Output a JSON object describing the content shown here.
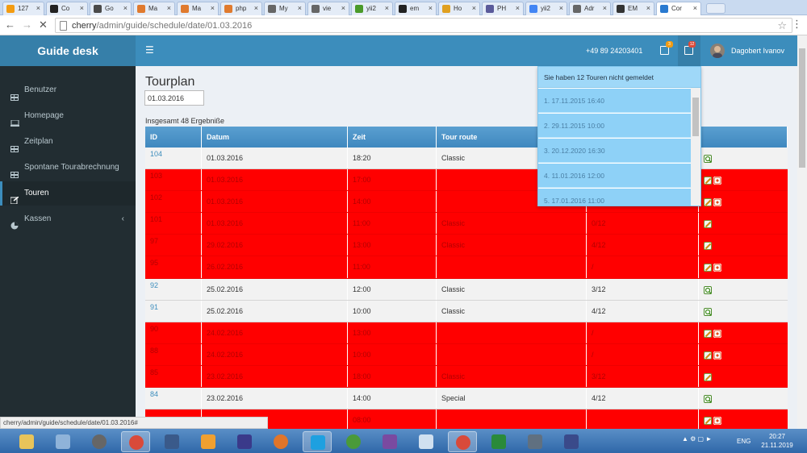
{
  "browser": {
    "tabs": [
      {
        "label": "127",
        "color": "#f39c12"
      },
      {
        "label": "Co",
        "color": "#222222"
      },
      {
        "label": "Go",
        "color": "#4a4a4a"
      },
      {
        "label": "Ma",
        "color": "#e07a2e"
      },
      {
        "label": "Ma",
        "color": "#e07a2e"
      },
      {
        "label": "php",
        "color": "#e07a2e"
      },
      {
        "label": "My",
        "color": "#666666"
      },
      {
        "label": "vie",
        "color": "#666666"
      },
      {
        "label": "yii2",
        "color": "#4a9a2a"
      },
      {
        "label": "em",
        "color": "#222222"
      },
      {
        "label": "Ho",
        "color": "#e0a020"
      },
      {
        "label": "PH",
        "color": "#5a5a9a"
      },
      {
        "label": "yii2",
        "color": "#4285f4"
      },
      {
        "label": "Adr",
        "color": "#666666"
      },
      {
        "label": "EM",
        "color": "#333333"
      },
      {
        "label": "Cor",
        "color": "#2a7ad0"
      }
    ],
    "tab_close": "×",
    "url_host": "cherry",
    "url_path": "/admin/guide/schedule/date/01.03.2016",
    "status_url": "cherry/admin/guide/schedule/date/01.03.2016#"
  },
  "header": {
    "logo": "Guide desk",
    "phone": "+49 89 24203401",
    "mail_badge": "3",
    "notif_badge": "12",
    "user": "Dagobert Ivanov"
  },
  "sidebar": {
    "items": [
      {
        "label": "Benutzer"
      },
      {
        "label": "Homepage"
      },
      {
        "label": "Zeitplan"
      },
      {
        "label": "Spontane Tourabrechnung"
      },
      {
        "label": "Touren"
      },
      {
        "label": "Kassen"
      }
    ]
  },
  "main": {
    "title": "Tourplan",
    "date_value": "01.03.2016",
    "total": "Insgesamt 48 Ergebniße",
    "columns": [
      "ID",
      "Datum",
      "Zeit",
      "Tour route",
      "",
      ""
    ],
    "rows": [
      {
        "id": "104",
        "date": "01.03.2016",
        "time": "18:20",
        "route": "Classic",
        "guides": "",
        "red": false,
        "actions": [
          "view"
        ]
      },
      {
        "id": "103",
        "date": "01.03.2016",
        "time": "17:00",
        "route": "",
        "guides": "",
        "red": true,
        "actions": [
          "edit",
          "delete"
        ]
      },
      {
        "id": "102",
        "date": "01.03.2016",
        "time": "14:00",
        "route": "",
        "guides": "",
        "red": true,
        "actions": [
          "edit",
          "delete"
        ]
      },
      {
        "id": "101",
        "date": "01.03.2016",
        "time": "11:00",
        "route": "Classic",
        "guides": "0/12",
        "red": true,
        "actions": [
          "edit"
        ]
      },
      {
        "id": "97",
        "date": "29.02.2016",
        "time": "13:00",
        "route": "Classic",
        "guides": "4/12",
        "red": true,
        "actions": [
          "edit"
        ]
      },
      {
        "id": "95",
        "date": "26.02.2016",
        "time": "11:00",
        "route": "",
        "guides": "/",
        "red": true,
        "actions": [
          "edit",
          "delete"
        ]
      },
      {
        "id": "92",
        "date": "25.02.2016",
        "time": "12:00",
        "route": "Classic",
        "guides": "3/12",
        "red": false,
        "actions": [
          "view"
        ]
      },
      {
        "id": "91",
        "date": "25.02.2016",
        "time": "10:00",
        "route": "Classic",
        "guides": "4/12",
        "red": false,
        "actions": [
          "view"
        ]
      },
      {
        "id": "90",
        "date": "24.02.2016",
        "time": "13:00",
        "route": "",
        "guides": "/",
        "red": true,
        "actions": [
          "edit",
          "delete"
        ]
      },
      {
        "id": "88",
        "date": "24.02.2016",
        "time": "10:00",
        "route": "",
        "guides": "/",
        "red": true,
        "actions": [
          "edit",
          "delete"
        ]
      },
      {
        "id": "85",
        "date": "23.02.2016",
        "time": "18:00",
        "route": "Classic",
        "guides": "3/12",
        "red": true,
        "actions": [
          "edit"
        ]
      },
      {
        "id": "84",
        "date": "23.02.2016",
        "time": "14:00",
        "route": "Special",
        "guides": "4/12",
        "red": false,
        "actions": [
          "view"
        ]
      },
      {
        "id": "",
        "date": "",
        "time": "08:00",
        "route": "",
        "guides": "",
        "red": true,
        "actions": [
          "edit",
          "delete"
        ]
      }
    ]
  },
  "dropdown": {
    "header": "Sie haben 12 Touren nicht gemeldet",
    "items": [
      "1. 17.11.2015 16:40",
      "2. 29.11.2015 10:00",
      "3. 20.12.2020 16:30",
      "4. 11.01.2016 12:00",
      "5. 17.01.2016 11:00"
    ]
  },
  "taskbar": {
    "lang": "ENG",
    "time": "20:27",
    "date": "21.11.2019",
    "apps": [
      "#e8c45a",
      "#8fb3d9",
      "#666666",
      "#d94a3a",
      "#3a5a8a",
      "#f0a030",
      "#3a3a8a",
      "#e0752a",
      "#1ea0e0",
      "#4a9a3a",
      "#7a4aa0",
      "#d0e0f0",
      "#d94a3a",
      "#2a8a3a",
      "#607080",
      "#3a4a8a"
    ]
  }
}
